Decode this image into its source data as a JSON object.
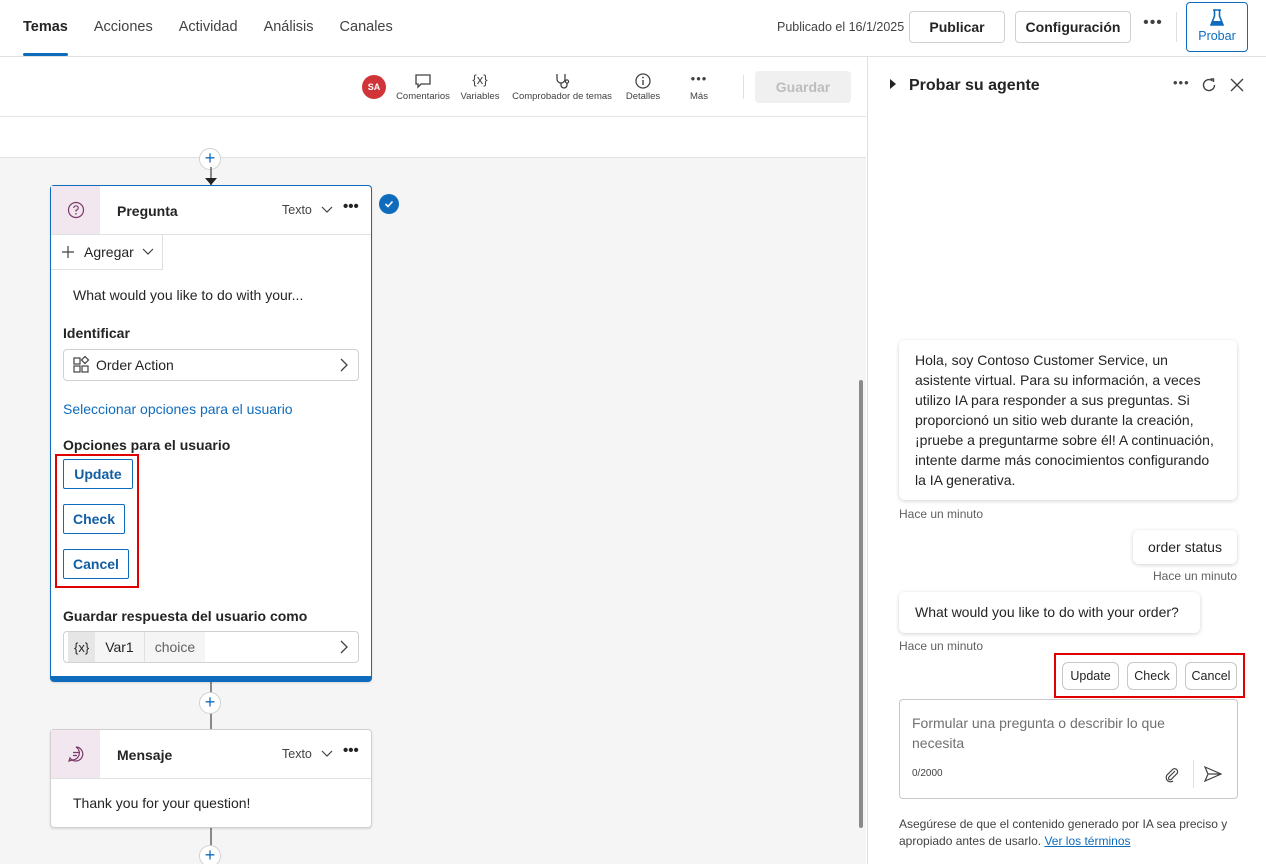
{
  "topbar": {
    "tabs": [
      {
        "label": "Temas"
      },
      {
        "label": "Acciones"
      },
      {
        "label": "Actividad"
      },
      {
        "label": "Análisis"
      },
      {
        "label": "Canales"
      }
    ],
    "published_text": "Publicado el 16/1/2025",
    "publicar_label": "Publicar",
    "config_label": "Configuración",
    "probar_label": "Probar",
    "accent_color": "#0f6cbd"
  },
  "toolbar": {
    "avatar_initials": "SA",
    "items": [
      {
        "label": "Comentarios",
        "icon": "comment-icon"
      },
      {
        "label": "Variables",
        "icon": "variables-icon"
      },
      {
        "label": "Comprobador de temas",
        "icon": "stethoscope-icon"
      },
      {
        "label": "Detalles",
        "icon": "info-icon"
      },
      {
        "label": "Más",
        "icon": "more-icon"
      }
    ],
    "guardar_label": "Guardar"
  },
  "question_node": {
    "title": "Pregunta",
    "type": "Texto",
    "add_label": "Agregar",
    "question_text": "What would you like to do with your...",
    "identify_label": "Identificar",
    "identify_value": "Order Action",
    "select_options_link": "Seleccionar opciones para el usuario",
    "options_label": "Opciones para el usuario",
    "options": [
      "Update",
      "Check",
      "Cancel"
    ],
    "save_label": "Guardar respuesta del usuario como",
    "var_symbol": "{x}",
    "var_name": "Var1",
    "var_type": "choice"
  },
  "message_node": {
    "title": "Mensaje",
    "type": "Texto",
    "text": "Thank you for your question!"
  },
  "panel": {
    "title": "Probar su agente",
    "greeting": "Hola, soy Contoso Customer Service, un asistente virtual. Para su información, a veces utilizo IA para responder a sus preguntas. Si proporcionó un sitio web durante la creación, ¡pruebe a preguntarme sobre él! A continuación, intente darme más conocimientos configurando la IA generativa.",
    "greeting_time": "Hace un minuto",
    "user_msg": "order status",
    "user_time": "Hace un minuto",
    "bot_question": "What would you like to do with your order?",
    "bot_question_time": "Hace un minuto",
    "chat_options": [
      "Update",
      "Check",
      "Cancel"
    ],
    "composer_placeholder": "Formular una pregunta o describir lo que necesita",
    "counter": "0/2000",
    "disclaimer": "Asegúrese de que el contenido generado por IA sea preciso y apropiado antes de usarlo.",
    "terms_link": "Ver los términos"
  }
}
